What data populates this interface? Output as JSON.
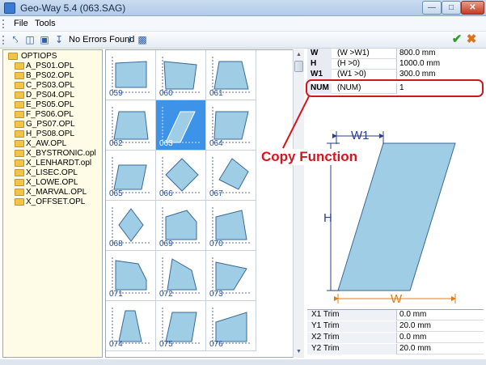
{
  "window": {
    "title": "Geo-Way 5.4 (063.SAG)"
  },
  "menu": {
    "file": "File",
    "tools": "Tools"
  },
  "toolbar": {
    "status": "No Errors Found"
  },
  "tree": {
    "root": "OPTIOPS",
    "items": [
      "A_PS01.OPL",
      "B_PS02.OPL",
      "C_PS03.OPL",
      "D_PS04.OPL",
      "E_PS05.OPL",
      "F_PS06.OPL",
      "G_PS07.OPL",
      "H_PS08.OPL",
      "X_AW.OPL",
      "X_BYSTRONIC.opl",
      "X_LENHARDT.opl",
      "X_LISEC.OPL",
      "X_LOWE.OPL",
      "X_MARVAL.OPL",
      "X_OFFSET.OPL"
    ]
  },
  "gallery": {
    "selected": "063",
    "shapes": [
      "059",
      "060",
      "061",
      "062",
      "063",
      "064",
      "065",
      "066",
      "067",
      "068",
      "069",
      "070",
      "071",
      "072",
      "073",
      "074",
      "075",
      "076"
    ]
  },
  "params": [
    {
      "name": "W",
      "cond": "(W >W1)",
      "value": "800.0 mm"
    },
    {
      "name": "H",
      "cond": "(H >0)",
      "value": "1000.0 mm"
    },
    {
      "name": "W1",
      "cond": "(W1 >0)",
      "value": "300.0 mm"
    },
    {
      "name": "NUM",
      "cond": "(NUM)",
      "value": "1"
    }
  ],
  "drawing": {
    "w1_label": "W1",
    "h_label": "H",
    "w_label": "W"
  },
  "trims": [
    {
      "name": "X1 Trim",
      "value": "0.0 mm"
    },
    {
      "name": "Y1 Trim",
      "value": "20.0 mm"
    },
    {
      "name": "X2 Trim",
      "value": "0.0 mm"
    },
    {
      "name": "Y2 Trim",
      "value": "20.0 mm"
    }
  ],
  "annotation": {
    "text": "Copy Function",
    "color": "#d0161f"
  },
  "colors": {
    "shape_fill": "#9fcde6",
    "shape_stroke": "#3a6a96",
    "selected": "#3c93e8",
    "dimension_blue": "#2a3f8f",
    "dimension_orange": "#e07b1a"
  }
}
